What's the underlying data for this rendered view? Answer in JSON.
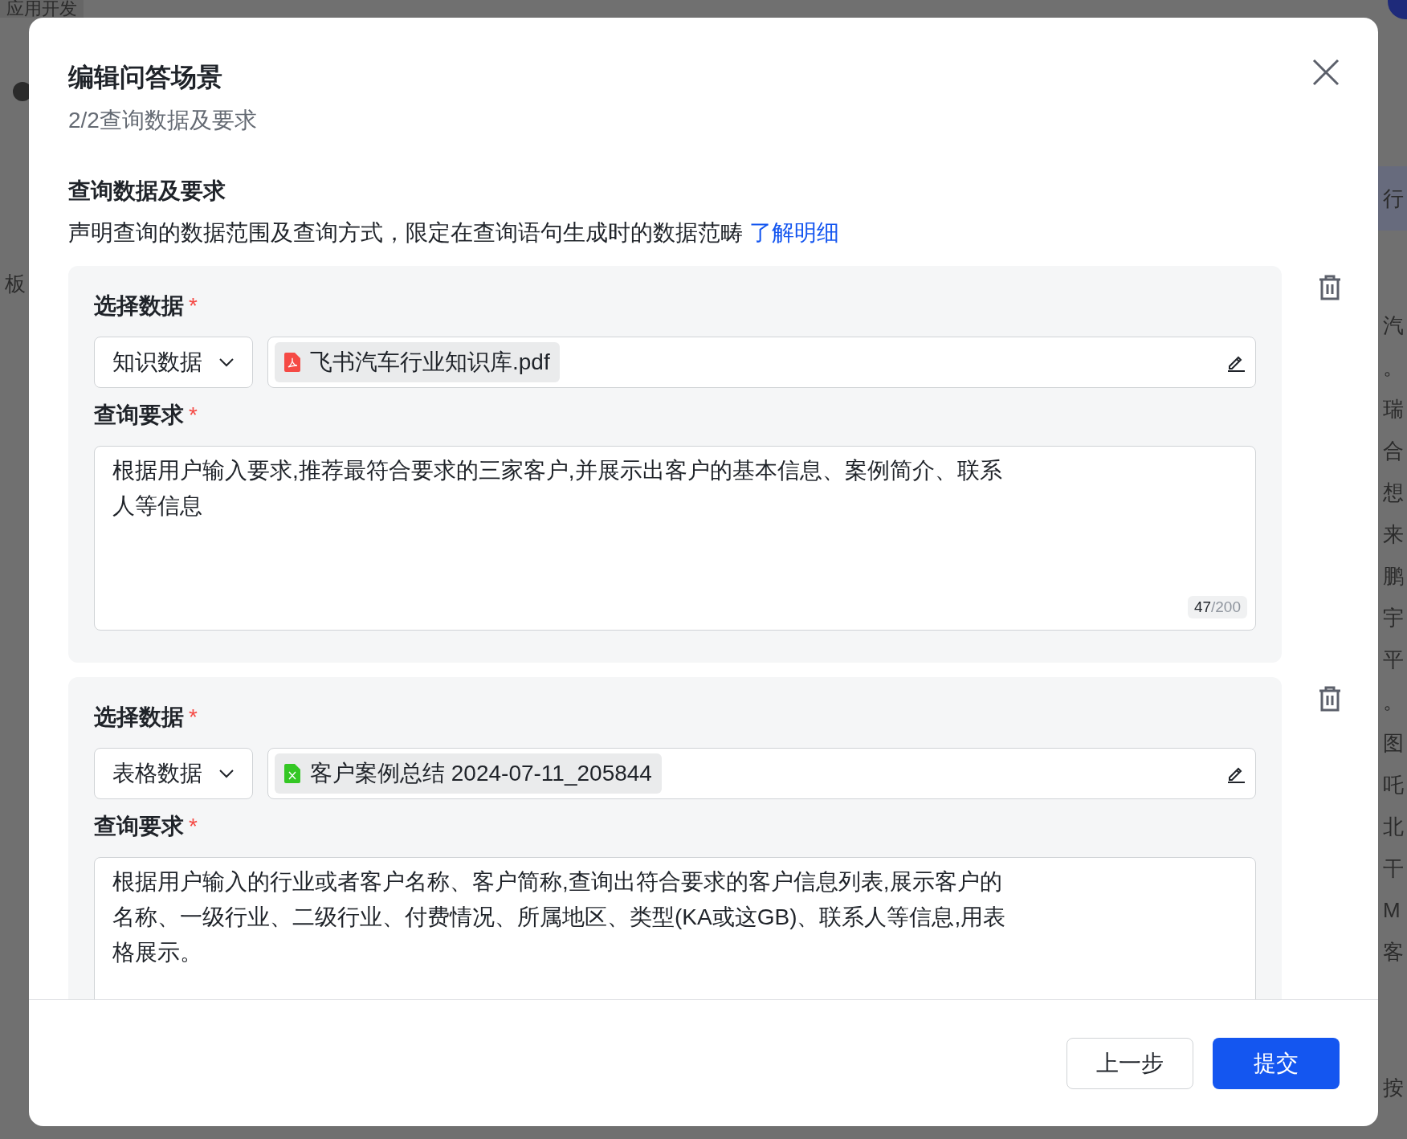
{
  "background": {
    "top_tab": "应用开发",
    "left_text": "板",
    "right_tab": "行",
    "right_lines": [
      "汽",
      "。",
      "瑞",
      "合",
      "想",
      "来",
      "鹏",
      "宇",
      "平",
      "。",
      "图",
      "吒",
      "北",
      "干",
      "M",
      "客"
    ],
    "bottom_text": "按"
  },
  "dialog": {
    "title": "编辑问答场景",
    "step": "2/2查询数据及要求",
    "section": {
      "title": "查询数据及要求",
      "description": "声明查询的数据范围及查询方式，限定在查询语句生成时的数据范畴",
      "link": "了解明细"
    },
    "cards": [
      {
        "data_label": "选择数据",
        "required_mark": "*",
        "data_type": "知识数据",
        "file": {
          "kind": "pdf",
          "name": "飞书汽车行业知识库.pdf"
        },
        "query_label": "查询要求",
        "query_required_mark": "*",
        "query": "根据用户输入要求,推荐最符合要求的三家客户,并展示出客户的基本信息、案例简介、联系人等信息",
        "counter": {
          "count": "47",
          "max": "/200"
        }
      },
      {
        "data_label": "选择数据",
        "required_mark": "*",
        "data_type": "表格数据",
        "file": {
          "kind": "sheet",
          "name": "客户案例总结 2024-07-11_205844"
        },
        "query_label": "查询要求",
        "query_required_mark": "*",
        "query": "根据用户输入的行业或者客户名称、客户简称,查询出符合要求的客户信息列表,展示客户的名称、一级行业、二级行业、付费情况、所属地区、类型(KA或这GB)、联系人等信息,用表格展示。"
      }
    ],
    "buttons": [
      {
        "kind": "secondary",
        "label": "上一步"
      },
      {
        "kind": "primary",
        "label": "提交"
      }
    ]
  }
}
